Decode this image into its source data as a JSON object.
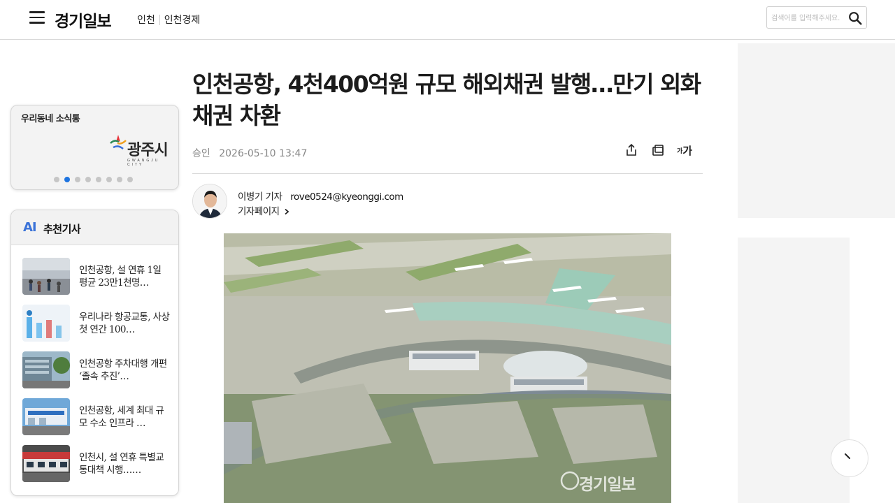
{
  "header": {
    "logo": "경기일보",
    "nav": [
      "인천",
      "인천경제"
    ],
    "search_placeholder": "검색어를 입력해주세요."
  },
  "left_widget": {
    "title": "우리동네 소식통",
    "banner_text": "광주시",
    "banner_sub": "GWANGJU CITY",
    "dots_total": 8,
    "dots_active": 2
  },
  "recommend": {
    "badge": "AI",
    "title": "추천기사",
    "items": [
      {
        "text": "인천공항, 설 연휴 1일 평균 23만1천명…"
      },
      {
        "text": "우리나라 항공교통, 사상 첫 연간 100…"
      },
      {
        "text": "인천공항 주차대행 개편 ‘졸속 추진’…"
      },
      {
        "text": "인천공항, 세계 최대 규모 수소 인프라 …"
      },
      {
        "text": "인천시, 설 연휴 특별교통대책 시행……"
      }
    ]
  },
  "article": {
    "headline": "인천공항, 4천400억원 규모 해외채권 발행…만기 외화채권 차환",
    "approved_label": "승인",
    "date": "2026-05-10 13:47",
    "font_tool_small": "가",
    "font_tool_large": "가",
    "reporter_name": "이병기 기자",
    "reporter_email": "rove0524@kyeonggi.com",
    "reporter_page": "기자페이지",
    "photo_watermark": "경기일보"
  },
  "colors": {
    "accent": "#1e74e0",
    "ad_bg": "#f4f4f4"
  }
}
